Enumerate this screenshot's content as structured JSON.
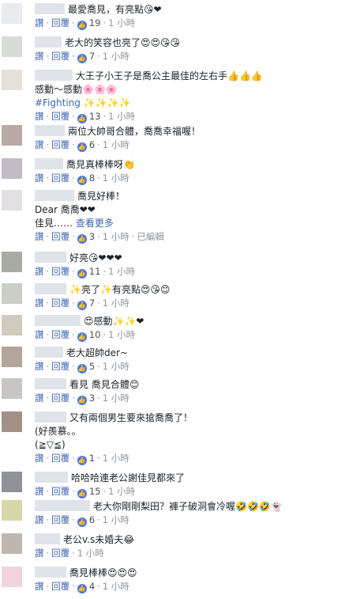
{
  "labels": {
    "like": "讚",
    "reply": "回覆",
    "edited": "已編輯",
    "see_more": "查看更多"
  },
  "comments": [
    {
      "avatar": "#e9ebee",
      "name_w": 38,
      "lines": [
        "最愛喬見，有亮點😘❤"
      ],
      "likes": "19",
      "time": "1 小時"
    },
    {
      "avatar": "#d9dbd8",
      "name_w": 34,
      "lines": [
        "老大的笑容也亮了😍😍😘😘"
      ],
      "likes": "7",
      "time": "1 小時"
    },
    {
      "avatar": "#e7dfd9",
      "name_w": 48,
      "lines": [
        "大王子小王子是喬公主最佳的左右手👍👍👍",
        "感動～感動🌸🌸🌸",
        "#Fighting ✨✨✨✨"
      ],
      "likes": "13",
      "time": "1 小時"
    },
    {
      "avatar": "#b9aaa6",
      "name_w": 38,
      "lines": [
        "兩位大帥哥合體，喬喬幸福喔！"
      ],
      "likes": "6",
      "time": "1 小時"
    },
    {
      "avatar": "#c2bcc6",
      "name_w": 36,
      "lines": [
        "喬見真棒棒呀👏"
      ],
      "likes": "8",
      "time": "1 小時"
    },
    {
      "avatar": "#e2e0e2",
      "name_w": 50,
      "lines": [
        "喬見好棒！",
        "Dear 喬喬❤❤",
        "佳見……"
      ],
      "more": true,
      "likes": "3",
      "time": "1 小時",
      "edited": true
    },
    {
      "avatar": "#a8aaa4",
      "name_w": 40,
      "lines": [
        "好亮😘❤❤❤"
      ],
      "likes": "11",
      "time": "1 小時"
    },
    {
      "avatar": "#c9cfc6",
      "name_w": 40,
      "lines": [
        "✨亮了✨有亮點😍😘😊"
      ],
      "likes": "7",
      "time": "1 小時"
    },
    {
      "avatar": "#cfcbbe",
      "name_w": 58,
      "lines": [
        "😍感動✨✨❤"
      ],
      "likes": "10",
      "time": "1 小時"
    },
    {
      "avatar": "#b3a59c",
      "name_w": 36,
      "lines": [
        "老大超帥der~"
      ],
      "likes": "5",
      "time": "1 小時"
    },
    {
      "avatar": "#c8c6c2",
      "name_w": 40,
      "lines": [
        "看見 喬見合體😊"
      ],
      "likes": "3",
      "time": "1 小時"
    },
    {
      "avatar": "#a39188",
      "name_w": 40,
      "lines": [
        "又有兩個男生要來搶喬喬了！",
        "(好羨慕。。",
        "(≧▽≦)"
      ],
      "likes": "1",
      "time": "1 小時"
    },
    {
      "avatar": "#8f9297",
      "name_w": 42,
      "lines": [
        "哈哈哈連老公謝佳見都來了"
      ],
      "likes": "15",
      "time": "1 小時"
    },
    {
      "avatar": "#d8d7a7",
      "name_w": 70,
      "lines": [
        "老大你剛剛梨田？褲子破洞會冷喔🤣🤣🤣👻"
      ],
      "likes": "6",
      "time": "1 小時"
    },
    {
      "avatar": "#bfb7ad",
      "name_w": 32,
      "lines": [
        "老公v.s未婚夫😂"
      ],
      "likes": "",
      "time": "1 小時"
    },
    {
      "avatar": "#f0d5de",
      "name_w": 40,
      "lines": [
        "喬見棒棒😍😍😍"
      ],
      "likes": "4",
      "time": "1 小時"
    }
  ]
}
